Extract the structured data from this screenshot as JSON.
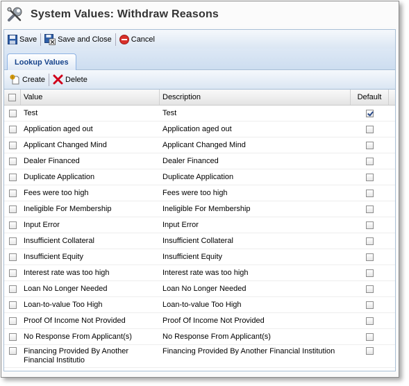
{
  "window": {
    "title": "System Values: Withdraw Reasons"
  },
  "toolbar": {
    "save_label": "Save",
    "save_close_label": "Save and Close",
    "cancel_label": "Cancel"
  },
  "tabs": [
    {
      "label": "Lookup Values",
      "active": true
    }
  ],
  "grid_toolbar": {
    "create_label": "Create",
    "delete_label": "Delete"
  },
  "columns": {
    "value": "Value",
    "description": "Description",
    "default": "Default"
  },
  "rows": [
    {
      "value": "Test",
      "description": "Test",
      "default": true
    },
    {
      "value": "Application aged out",
      "description": "Application aged out",
      "default": false
    },
    {
      "value": "Applicant Changed Mind",
      "description": "Applicant Changed Mind",
      "default": false
    },
    {
      "value": "Dealer Financed",
      "description": "Dealer Financed",
      "default": false
    },
    {
      "value": "Duplicate Application",
      "description": "Duplicate Application",
      "default": false
    },
    {
      "value": "Fees were too high",
      "description": "Fees were too high",
      "default": false
    },
    {
      "value": "Ineligible For Membership",
      "description": "Ineligible For Membership",
      "default": false
    },
    {
      "value": "Input Error",
      "description": "Input Error",
      "default": false
    },
    {
      "value": "Insufficient Collateral",
      "description": "Insufficient Collateral",
      "default": false
    },
    {
      "value": "Insufficient Equity",
      "description": "Insufficient Equity",
      "default": false
    },
    {
      "value": "Interest rate was too high",
      "description": "Interest rate was too high",
      "default": false
    },
    {
      "value": "Loan No Longer Needed",
      "description": "Loan No Longer Needed",
      "default": false
    },
    {
      "value": "Loan-to-value Too High",
      "description": "Loan-to-value Too High",
      "default": false
    },
    {
      "value": "Proof Of Income Not Provided",
      "description": "Proof Of Income Not Provided",
      "default": false
    },
    {
      "value": "No Response From Applicant(s)",
      "description": "No Response From Applicant(s)",
      "default": false
    },
    {
      "value": "Financing Provided By Another Financial Institutio",
      "description": "Financing Provided By Another Financial Institution",
      "default": false
    }
  ],
  "icons": {
    "title": "wrench-icon",
    "save": "save-icon",
    "save_close": "save-close-icon",
    "cancel": "cancel-icon",
    "create": "create-icon",
    "delete": "delete-icon"
  },
  "colors": {
    "tab_text": "#15428b",
    "toolbar_border": "#a9bfd6",
    "cancel_red": "#d9302b",
    "delete_red": "#d0021b"
  }
}
